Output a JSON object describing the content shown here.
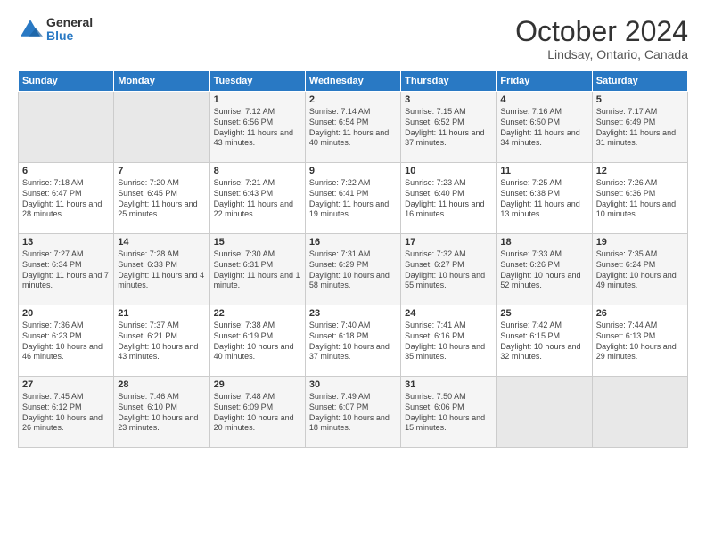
{
  "logo": {
    "line1": "General",
    "line2": "Blue"
  },
  "header": {
    "title": "October 2024",
    "location": "Lindsay, Ontario, Canada"
  },
  "days": [
    "Sunday",
    "Monday",
    "Tuesday",
    "Wednesday",
    "Thursday",
    "Friday",
    "Saturday"
  ],
  "weeks": [
    [
      {
        "num": "",
        "sunrise": "",
        "sunset": "",
        "daylight": "",
        "empty": true
      },
      {
        "num": "",
        "sunrise": "",
        "sunset": "",
        "daylight": "",
        "empty": true
      },
      {
        "num": "1",
        "sunrise": "Sunrise: 7:12 AM",
        "sunset": "Sunset: 6:56 PM",
        "daylight": "Daylight: 11 hours and 43 minutes."
      },
      {
        "num": "2",
        "sunrise": "Sunrise: 7:14 AM",
        "sunset": "Sunset: 6:54 PM",
        "daylight": "Daylight: 11 hours and 40 minutes."
      },
      {
        "num": "3",
        "sunrise": "Sunrise: 7:15 AM",
        "sunset": "Sunset: 6:52 PM",
        "daylight": "Daylight: 11 hours and 37 minutes."
      },
      {
        "num": "4",
        "sunrise": "Sunrise: 7:16 AM",
        "sunset": "Sunset: 6:50 PM",
        "daylight": "Daylight: 11 hours and 34 minutes."
      },
      {
        "num": "5",
        "sunrise": "Sunrise: 7:17 AM",
        "sunset": "Sunset: 6:49 PM",
        "daylight": "Daylight: 11 hours and 31 minutes."
      }
    ],
    [
      {
        "num": "6",
        "sunrise": "Sunrise: 7:18 AM",
        "sunset": "Sunset: 6:47 PM",
        "daylight": "Daylight: 11 hours and 28 minutes."
      },
      {
        "num": "7",
        "sunrise": "Sunrise: 7:20 AM",
        "sunset": "Sunset: 6:45 PM",
        "daylight": "Daylight: 11 hours and 25 minutes."
      },
      {
        "num": "8",
        "sunrise": "Sunrise: 7:21 AM",
        "sunset": "Sunset: 6:43 PM",
        "daylight": "Daylight: 11 hours and 22 minutes."
      },
      {
        "num": "9",
        "sunrise": "Sunrise: 7:22 AM",
        "sunset": "Sunset: 6:41 PM",
        "daylight": "Daylight: 11 hours and 19 minutes."
      },
      {
        "num": "10",
        "sunrise": "Sunrise: 7:23 AM",
        "sunset": "Sunset: 6:40 PM",
        "daylight": "Daylight: 11 hours and 16 minutes."
      },
      {
        "num": "11",
        "sunrise": "Sunrise: 7:25 AM",
        "sunset": "Sunset: 6:38 PM",
        "daylight": "Daylight: 11 hours and 13 minutes."
      },
      {
        "num": "12",
        "sunrise": "Sunrise: 7:26 AM",
        "sunset": "Sunset: 6:36 PM",
        "daylight": "Daylight: 11 hours and 10 minutes."
      }
    ],
    [
      {
        "num": "13",
        "sunrise": "Sunrise: 7:27 AM",
        "sunset": "Sunset: 6:34 PM",
        "daylight": "Daylight: 11 hours and 7 minutes."
      },
      {
        "num": "14",
        "sunrise": "Sunrise: 7:28 AM",
        "sunset": "Sunset: 6:33 PM",
        "daylight": "Daylight: 11 hours and 4 minutes."
      },
      {
        "num": "15",
        "sunrise": "Sunrise: 7:30 AM",
        "sunset": "Sunset: 6:31 PM",
        "daylight": "Daylight: 11 hours and 1 minute."
      },
      {
        "num": "16",
        "sunrise": "Sunrise: 7:31 AM",
        "sunset": "Sunset: 6:29 PM",
        "daylight": "Daylight: 10 hours and 58 minutes."
      },
      {
        "num": "17",
        "sunrise": "Sunrise: 7:32 AM",
        "sunset": "Sunset: 6:27 PM",
        "daylight": "Daylight: 10 hours and 55 minutes."
      },
      {
        "num": "18",
        "sunrise": "Sunrise: 7:33 AM",
        "sunset": "Sunset: 6:26 PM",
        "daylight": "Daylight: 10 hours and 52 minutes."
      },
      {
        "num": "19",
        "sunrise": "Sunrise: 7:35 AM",
        "sunset": "Sunset: 6:24 PM",
        "daylight": "Daylight: 10 hours and 49 minutes."
      }
    ],
    [
      {
        "num": "20",
        "sunrise": "Sunrise: 7:36 AM",
        "sunset": "Sunset: 6:23 PM",
        "daylight": "Daylight: 10 hours and 46 minutes."
      },
      {
        "num": "21",
        "sunrise": "Sunrise: 7:37 AM",
        "sunset": "Sunset: 6:21 PM",
        "daylight": "Daylight: 10 hours and 43 minutes."
      },
      {
        "num": "22",
        "sunrise": "Sunrise: 7:38 AM",
        "sunset": "Sunset: 6:19 PM",
        "daylight": "Daylight: 10 hours and 40 minutes."
      },
      {
        "num": "23",
        "sunrise": "Sunrise: 7:40 AM",
        "sunset": "Sunset: 6:18 PM",
        "daylight": "Daylight: 10 hours and 37 minutes."
      },
      {
        "num": "24",
        "sunrise": "Sunrise: 7:41 AM",
        "sunset": "Sunset: 6:16 PM",
        "daylight": "Daylight: 10 hours and 35 minutes."
      },
      {
        "num": "25",
        "sunrise": "Sunrise: 7:42 AM",
        "sunset": "Sunset: 6:15 PM",
        "daylight": "Daylight: 10 hours and 32 minutes."
      },
      {
        "num": "26",
        "sunrise": "Sunrise: 7:44 AM",
        "sunset": "Sunset: 6:13 PM",
        "daylight": "Daylight: 10 hours and 29 minutes."
      }
    ],
    [
      {
        "num": "27",
        "sunrise": "Sunrise: 7:45 AM",
        "sunset": "Sunset: 6:12 PM",
        "daylight": "Daylight: 10 hours and 26 minutes."
      },
      {
        "num": "28",
        "sunrise": "Sunrise: 7:46 AM",
        "sunset": "Sunset: 6:10 PM",
        "daylight": "Daylight: 10 hours and 23 minutes."
      },
      {
        "num": "29",
        "sunrise": "Sunrise: 7:48 AM",
        "sunset": "Sunset: 6:09 PM",
        "daylight": "Daylight: 10 hours and 20 minutes."
      },
      {
        "num": "30",
        "sunrise": "Sunrise: 7:49 AM",
        "sunset": "Sunset: 6:07 PM",
        "daylight": "Daylight: 10 hours and 18 minutes."
      },
      {
        "num": "31",
        "sunrise": "Sunrise: 7:50 AM",
        "sunset": "Sunset: 6:06 PM",
        "daylight": "Daylight: 10 hours and 15 minutes."
      },
      {
        "num": "",
        "sunrise": "",
        "sunset": "",
        "daylight": "",
        "empty": true
      },
      {
        "num": "",
        "sunrise": "",
        "sunset": "",
        "daylight": "",
        "empty": true
      }
    ]
  ]
}
